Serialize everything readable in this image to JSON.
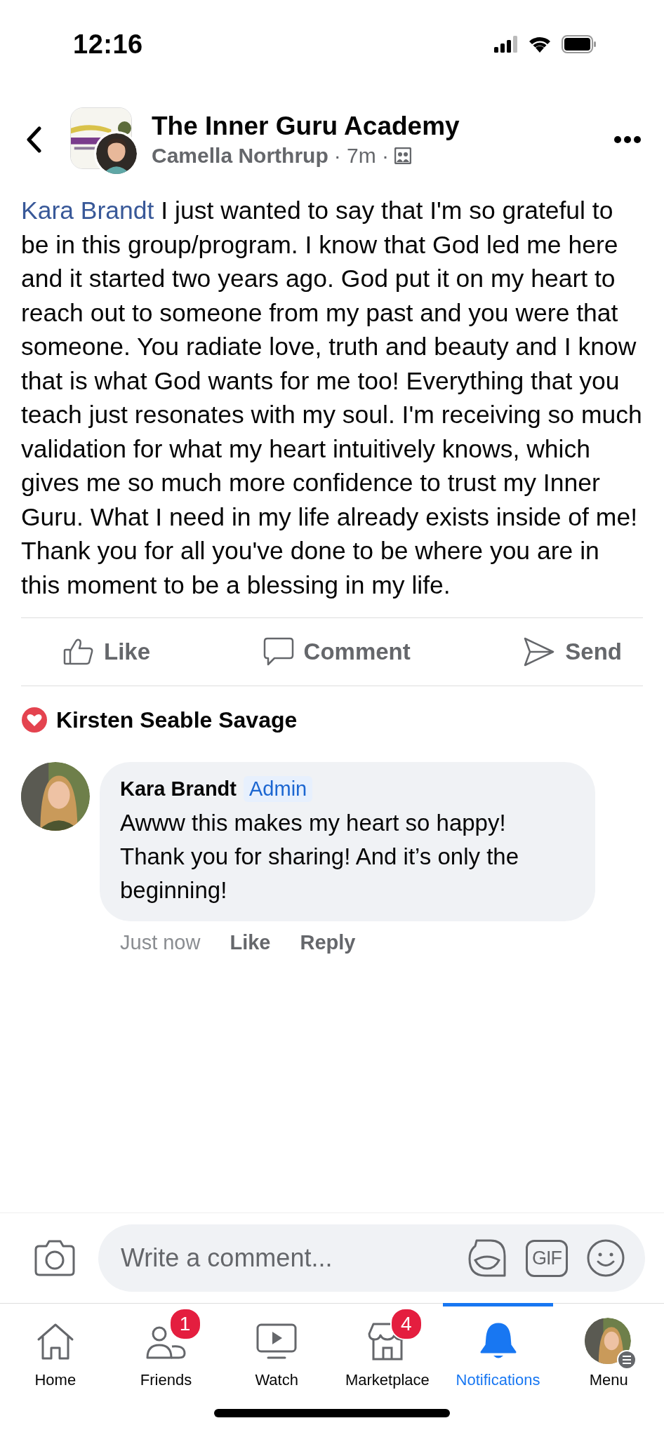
{
  "status_bar": {
    "time": "12:16"
  },
  "header": {
    "group_name": "The Inner Guru Academy",
    "author": "Camella Northrup",
    "time": "· 7m ·"
  },
  "post": {
    "mention": "Kara Brandt",
    "text": " I just wanted to say that I'm so grateful to be in this group/program. I know that God led me here and it started two years ago. God put it on my heart to reach out to someone from my past and you were that someone.  You radiate love, truth and beauty and I know that is what God wants for me too! Everything that you teach just resonates with my soul. I'm receiving so much validation for what my heart intuitively knows, which gives me so much more confidence to trust my Inner Guru.  What I need in my life already exists inside of me!  Thank you for all you've done to be where you are in this moment to be a blessing in my life."
  },
  "actions": [
    {
      "kind": "like",
      "label": "Like"
    },
    {
      "kind": "comment",
      "label": "Comment"
    },
    {
      "kind": "send",
      "label": "Send"
    }
  ],
  "reaction": {
    "kind": "love",
    "name": "Kirsten Seable Savage"
  },
  "comment": {
    "author": "Kara Brandt",
    "badge": "Admin",
    "text": "Awww this makes my heart so happy! Thank you for sharing! And it’s only the beginning!",
    "time": "Just now",
    "like": "Like",
    "reply": "Reply"
  },
  "composer": {
    "placeholder": "Write a comment...",
    "gif": "GIF"
  },
  "tabs": [
    {
      "kind": "home",
      "label": "Home",
      "selected": false
    },
    {
      "kind": "friends",
      "label": "Friends",
      "badge": "1",
      "selected": false
    },
    {
      "kind": "watch",
      "label": "Watch",
      "selected": false
    },
    {
      "kind": "marketplace",
      "label": "Marketplace",
      "badge": "4",
      "selected": false
    },
    {
      "kind": "notifications",
      "label": "Notifications",
      "selected": true
    },
    {
      "kind": "menu",
      "label": "Menu",
      "selected": false
    }
  ]
}
